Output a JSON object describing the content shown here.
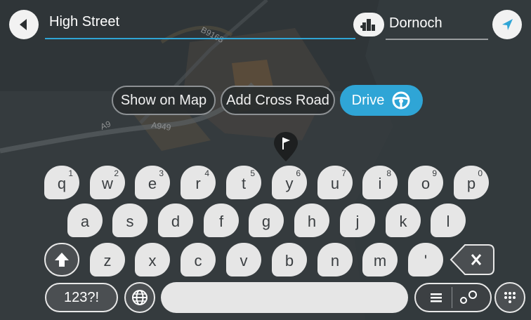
{
  "search": {
    "query": "High Street",
    "area": "Dornoch"
  },
  "map": {
    "road_labels": [
      "B9168",
      "A9",
      "A949"
    ]
  },
  "actions": {
    "show_on_map": "Show on Map",
    "add_cross_road": "Add Cross Road",
    "drive": "Drive"
  },
  "keyboard": {
    "row1": [
      {
        "key": "q",
        "alt": "1"
      },
      {
        "key": "w",
        "alt": "2"
      },
      {
        "key": "e",
        "alt": "3"
      },
      {
        "key": "r",
        "alt": "4"
      },
      {
        "key": "t",
        "alt": "5"
      },
      {
        "key": "y",
        "alt": "6"
      },
      {
        "key": "u",
        "alt": "7"
      },
      {
        "key": "i",
        "alt": "8"
      },
      {
        "key": "o",
        "alt": "9"
      },
      {
        "key": "p",
        "alt": "0"
      }
    ],
    "row2": [
      "a",
      "s",
      "d",
      "f",
      "g",
      "h",
      "j",
      "k",
      "l"
    ],
    "row3": [
      "z",
      "x",
      "c",
      "v",
      "b",
      "n",
      "m",
      "'"
    ],
    "symbols_label": "123?!"
  },
  "colors": {
    "accent": "#2fa5d6",
    "key": "#e6e6e6",
    "background": "#30363a"
  },
  "icons": {
    "back": "back-arrow-icon",
    "area": "city-icon",
    "navigate": "navigation-arrow-icon",
    "shift": "shift-arrow-icon",
    "delete": "backspace-icon",
    "globe": "globe-icon",
    "list": "list-view-icon",
    "map_view": "map-view-icon",
    "keypad": "keypad-icon",
    "steering": "steering-wheel-icon",
    "flag": "flag-marker-icon"
  }
}
